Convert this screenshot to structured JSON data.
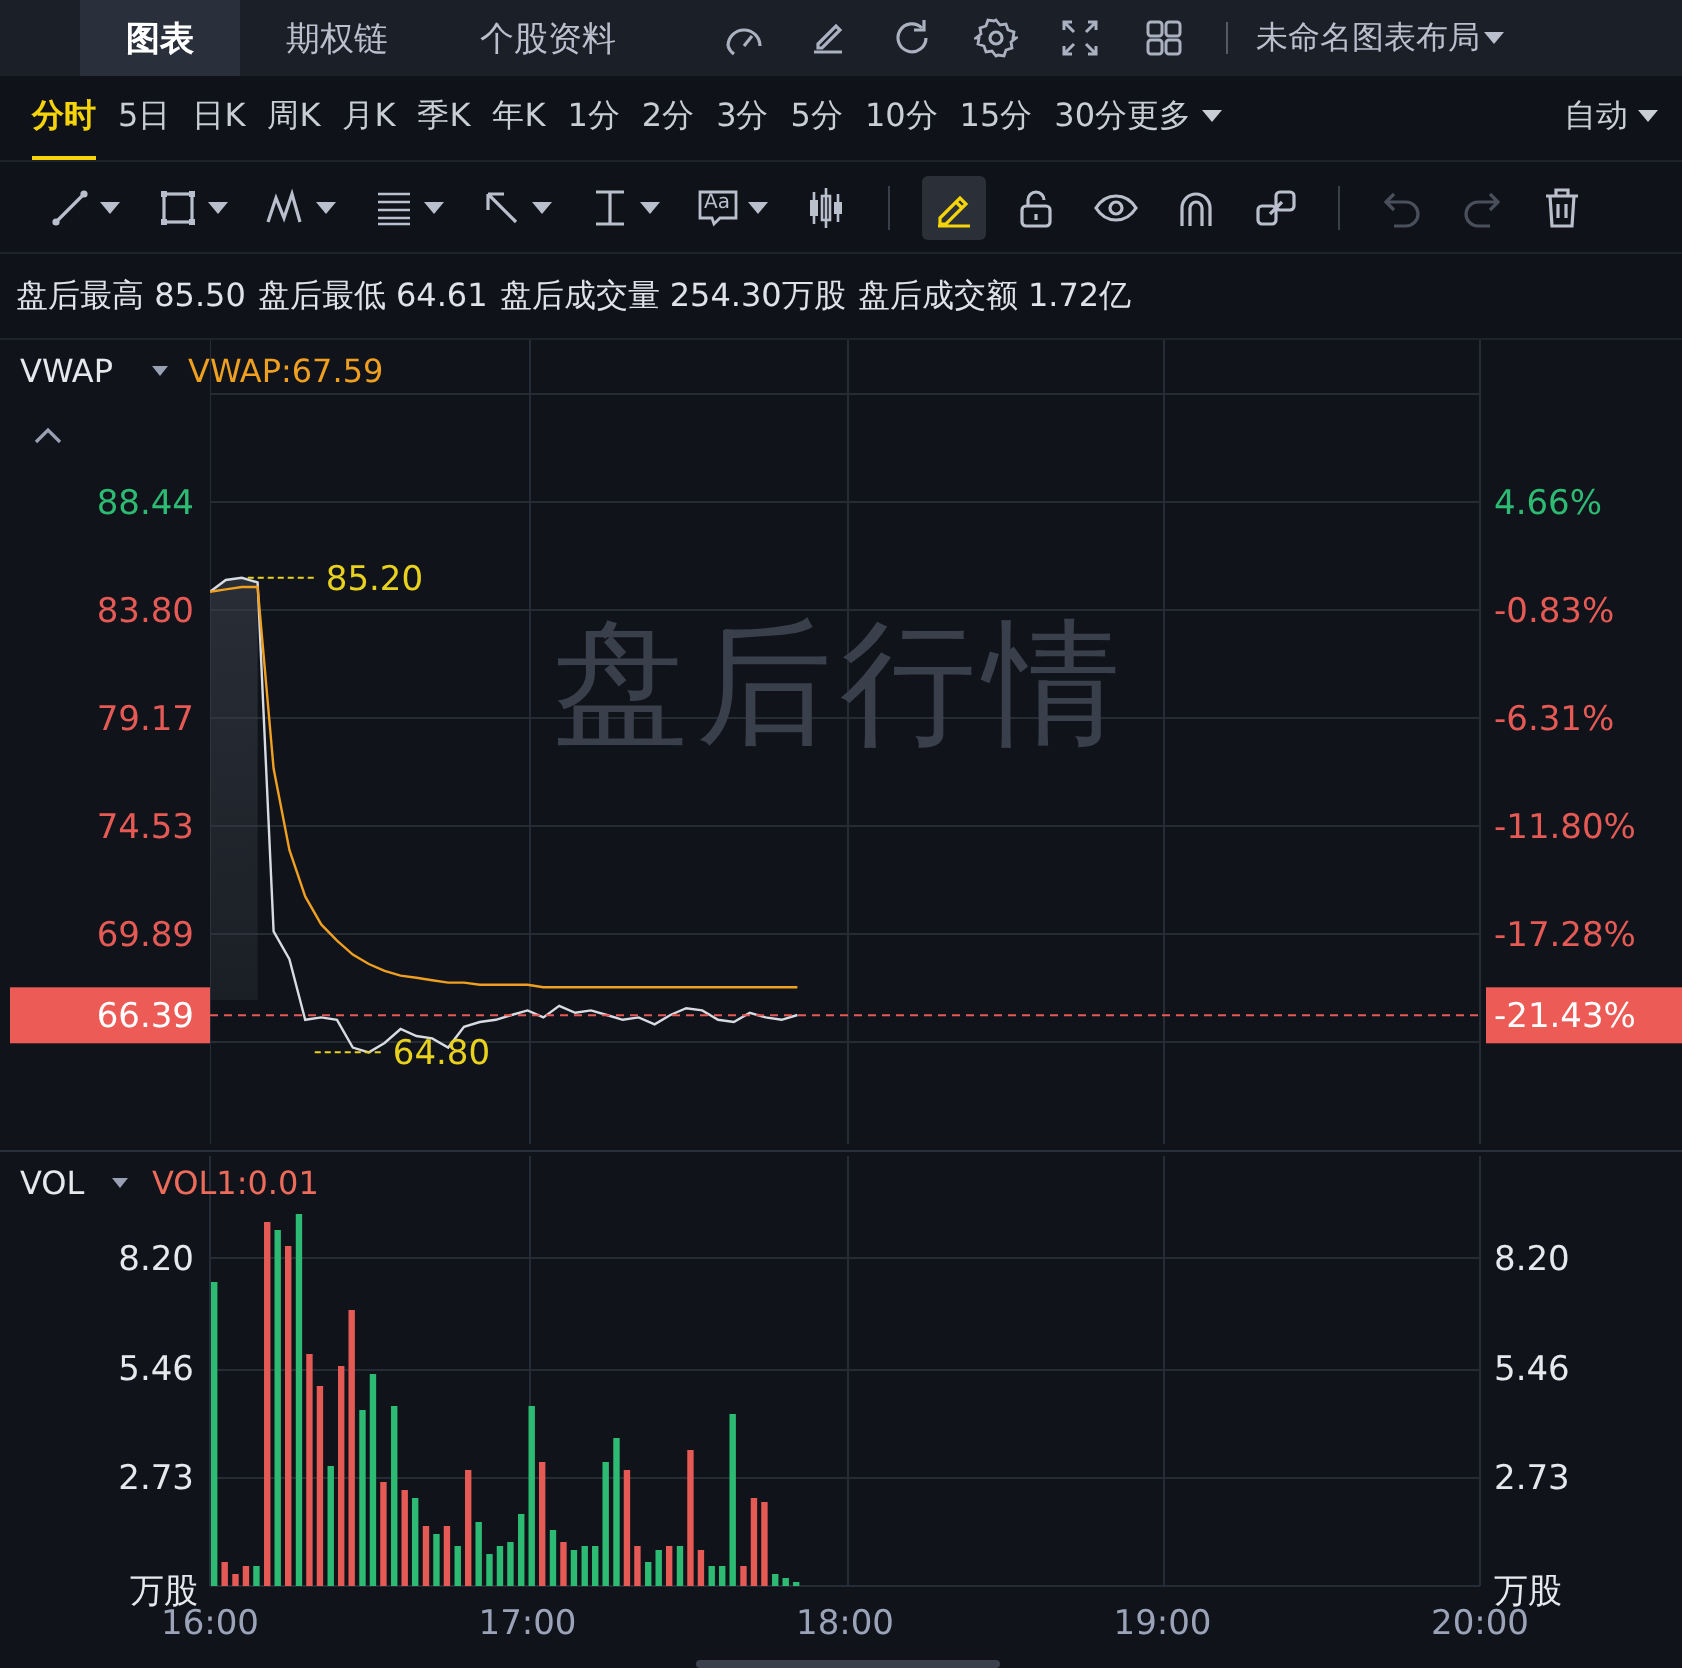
{
  "top_bar": {
    "tabs": [
      {
        "label": "图表",
        "selected": true
      },
      {
        "label": "期权链",
        "selected": false
      },
      {
        "label": "个股资料",
        "selected": false
      }
    ],
    "icons": [
      {
        "kind": "gauge"
      },
      {
        "kind": "edit"
      },
      {
        "kind": "refresh"
      },
      {
        "kind": "settings"
      },
      {
        "kind": "fullscreen"
      },
      {
        "kind": "layout"
      }
    ],
    "layout_name": "未命名图表布局"
  },
  "periods": [
    {
      "label": "分时",
      "selected": true
    },
    {
      "label": "5日",
      "selected": false
    },
    {
      "label": "日K",
      "selected": false
    },
    {
      "label": "周K",
      "selected": false
    },
    {
      "label": "月K",
      "selected": false
    },
    {
      "label": "季K",
      "selected": false
    },
    {
      "label": "年K",
      "selected": false
    },
    {
      "label": "1分",
      "selected": false
    },
    {
      "label": "2分",
      "selected": false
    },
    {
      "label": "3分",
      "selected": false
    },
    {
      "label": "5分",
      "selected": false
    },
    {
      "label": "10分",
      "selected": false
    },
    {
      "label": "15分",
      "selected": false
    },
    {
      "label": "30分",
      "selected": false
    }
  ],
  "more_periods": "更多",
  "scale_mode": "自动",
  "tools": [
    {
      "kind": "line",
      "dropdown": true,
      "selected": false,
      "disabled": false
    },
    {
      "kind": "rect",
      "dropdown": true,
      "selected": false,
      "disabled": false
    },
    {
      "kind": "pattern",
      "dropdown": true,
      "selected": false,
      "disabled": false
    },
    {
      "kind": "fib",
      "dropdown": true,
      "selected": false,
      "disabled": false
    },
    {
      "kind": "arrow",
      "dropdown": true,
      "selected": false,
      "disabled": false
    },
    {
      "kind": "measure",
      "dropdown": true,
      "selected": false,
      "disabled": false
    },
    {
      "kind": "text",
      "label": "Aa",
      "dropdown": true,
      "selected": false,
      "disabled": false
    },
    {
      "kind": "candles",
      "dropdown": false,
      "selected": false,
      "disabled": false
    },
    {
      "kind": "separator"
    },
    {
      "kind": "pencil",
      "dropdown": false,
      "selected": true,
      "disabled": false
    },
    {
      "kind": "lock",
      "dropdown": false,
      "selected": false,
      "disabled": false
    },
    {
      "kind": "eye",
      "dropdown": false,
      "selected": false,
      "disabled": false
    },
    {
      "kind": "magnet",
      "dropdown": false,
      "selected": false,
      "disabled": false
    },
    {
      "kind": "link",
      "dropdown": false,
      "selected": false,
      "disabled": false
    },
    {
      "kind": "separator"
    },
    {
      "kind": "undo",
      "dropdown": false,
      "selected": false,
      "disabled": true
    },
    {
      "kind": "redo",
      "dropdown": false,
      "selected": false,
      "disabled": true
    },
    {
      "kind": "trash",
      "dropdown": false,
      "selected": false,
      "disabled": false
    }
  ],
  "stats": [
    {
      "label": "盘后最高",
      "value": "85.50"
    },
    {
      "label": "盘后最低",
      "value": "64.61"
    },
    {
      "label": "盘后成交量",
      "value": "254.30万股"
    },
    {
      "label": "盘后成交额",
      "value": "1.72亿"
    }
  ],
  "price_panel": {
    "indicator": "VWAP",
    "indicator_value": "VWAP:67.59",
    "background_label": "盘后行情",
    "right_axis": [
      {
        "label": "4.66%",
        "color": "#2dbb73"
      },
      {
        "label": "-0.83%",
        "color": "#e55a55"
      },
      {
        "label": "-6.31%",
        "color": "#e55a55"
      },
      {
        "label": "-11.80%",
        "color": "#e55a55"
      },
      {
        "label": "-17.28%",
        "color": "#e55a55"
      }
    ],
    "current_change": "-21.43%",
    "chart_data": {
      "type": "line",
      "grid": true,
      "ref_lines": [
        {
          "value": 66.39,
          "axis": "y",
          "label": "66.39",
          "color": "#e55a55"
        }
      ],
      "categories": [
        null,
        null,
        null,
        null,
        null,
        null,
        null,
        null,
        null,
        null,
        null,
        null,
        null,
        null,
        null,
        null,
        null,
        null,
        null,
        null,
        null,
        null,
        null,
        null,
        null,
        null,
        null,
        null,
        null,
        null,
        null,
        null,
        null,
        null,
        null,
        null,
        null,
        null,
        null,
        null,
        null,
        null,
        null,
        null,
        null,
        null,
        null,
        null,
        null,
        null,
        null,
        null,
        null,
        null,
        null,
        null,
        null,
        null,
        null,
        null,
        null,
        null,
        null,
        null,
        null,
        null,
        null,
        null,
        null,
        null,
        null,
        null,
        null,
        null,
        null,
        null,
        null,
        null,
        null,
        null,
        null
      ],
      "series": [
        {
          "color": "#d8dbe2",
          "values": [
            84.6,
            85.1,
            85.2,
            85.0,
            70.0,
            68.8,
            66.2,
            66.3,
            66.2,
            65.0,
            64.8,
            65.2,
            65.8,
            65.5,
            65.4,
            65.0,
            65.9,
            66.1,
            66.2,
            66.4,
            66.6,
            66.3,
            66.8,
            66.5,
            66.6,
            66.4,
            66.2,
            66.3,
            66.0,
            66.4,
            66.7,
            66.6,
            66.2,
            66.1,
            66.5,
            66.3,
            66.2,
            66.4,
            null,
            null,
            null,
            null,
            null,
            null,
            null,
            null,
            null,
            null,
            null,
            null,
            null,
            null,
            null,
            null,
            null,
            null,
            null,
            null,
            null,
            null,
            null,
            null,
            null,
            null,
            null,
            null,
            null,
            null,
            null,
            null,
            null,
            null,
            null,
            null,
            null,
            null,
            null,
            null,
            null,
            null,
            null
          ]
        },
        {
          "color": "#f0a020",
          "values": [
            84.6,
            84.7,
            84.8,
            84.8,
            77.0,
            73.5,
            71.5,
            70.3,
            69.6,
            69.0,
            68.6,
            68.3,
            68.1,
            68.0,
            67.9,
            67.8,
            67.8,
            67.7,
            67.7,
            67.7,
            67.7,
            67.6,
            67.6,
            67.6,
            67.6,
            67.6,
            67.6,
            67.6,
            67.6,
            67.6,
            67.6,
            67.6,
            67.6,
            67.6,
            67.6,
            67.6,
            67.6,
            67.6,
            null,
            null,
            null,
            null,
            null,
            null,
            null,
            null,
            null,
            null,
            null,
            null,
            null,
            null,
            null,
            null,
            null,
            null,
            null,
            null,
            null,
            null,
            null,
            null,
            null,
            null,
            null,
            null,
            null,
            null,
            null,
            null,
            null,
            null,
            null,
            null,
            null,
            null,
            null,
            null,
            null,
            null,
            null
          ]
        }
      ],
      "ylim": [
        60.6,
        93.1
      ],
      "yticks": [
        {
          "value": 88.44,
          "label": "88.44"
        },
        {
          "value": 83.8,
          "label": "83.80"
        },
        {
          "value": 79.17,
          "label": "79.17"
        },
        {
          "value": 74.53,
          "label": "74.53"
        },
        {
          "value": 69.89,
          "label": "69.89"
        }
      ],
      "annotations": [
        "85.20",
        "64.80"
      ]
    }
  },
  "volume_panel": {
    "indicator": "VOL",
    "indicator_value": "VOL1:0.01",
    "unit_left": "万股",
    "unit_right": "万股",
    "right_ticks": [
      "8.20",
      "5.46",
      "2.73"
    ],
    "chart_data": {
      "type": "bar",
      "stacked": true,
      "grid": true,
      "x": [
        16,
        16.033,
        16.067,
        16.1,
        16.133,
        16.167,
        16.2,
        16.233,
        16.267,
        16.3,
        16.333,
        16.367,
        16.4,
        16.433,
        16.467,
        16.5,
        16.533,
        16.567,
        16.6,
        16.633,
        16.667,
        16.7,
        16.733,
        16.767,
        16.8,
        16.833,
        16.867,
        16.9,
        16.933,
        16.967,
        17,
        17.033,
        17.067,
        17.1,
        17.133,
        17.167,
        17.2,
        17.233,
        17.267,
        17.3,
        17.333,
        17.367,
        17.4,
        17.433,
        17.467,
        17.5,
        17.533,
        17.567,
        17.6,
        17.633,
        17.667,
        17.7,
        17.733,
        17.767,
        17.8,
        17.833
      ],
      "series": [
        {
          "color": "#e55a55",
          "values": [
            null,
            0.6,
            0.3,
            0.5,
            null,
            9.1,
            null,
            8.5,
            null,
            5.8,
            5.0,
            null,
            5.5,
            6.9,
            null,
            null,
            2.6,
            null,
            2.4,
            null,
            1.5,
            null,
            1.5,
            null,
            2.9,
            null,
            null,
            null,
            null,
            null,
            null,
            3.1,
            null,
            1.1,
            null,
            null,
            null,
            null,
            null,
            2.9,
            1.0,
            null,
            null,
            1.0,
            null,
            3.4,
            0.9,
            null,
            null,
            null,
            0.5,
            2.2,
            2.1,
            null,
            null,
            null
          ]
        },
        {
          "color": "#2dbb73",
          "values": [
            7.6,
            null,
            null,
            null,
            0.5,
            null,
            8.9,
            null,
            9.3,
            null,
            null,
            3.0,
            null,
            null,
            4.4,
            5.3,
            null,
            4.5,
            null,
            2.2,
            null,
            1.3,
            null,
            1.0,
            null,
            1.6,
            0.8,
            1.0,
            1.1,
            1.8,
            4.5,
            null,
            1.4,
            null,
            0.9,
            1.0,
            1.0,
            3.1,
            3.7,
            null,
            null,
            0.6,
            0.9,
            null,
            1.0,
            null,
            null,
            0.5,
            0.5,
            4.3,
            null,
            null,
            null,
            0.3,
            0.2,
            0.1
          ]
        }
      ],
      "xlim": [
        16,
        20
      ],
      "ylim": [
        0,
        10.9
      ],
      "yticks": [
        {
          "value": 8.2,
          "label": "8.20"
        },
        {
          "value": 5.46,
          "label": "5.46"
        },
        {
          "value": 2.73,
          "label": "2.73"
        }
      ],
      "xticks": [
        {
          "value": 16,
          "label": "16:00"
        },
        {
          "value": 17,
          "label": "17:00"
        },
        {
          "value": 18,
          "label": "18:00"
        },
        {
          "value": 19,
          "label": "19:00"
        },
        {
          "value": 20,
          "label": "20:00"
        }
      ]
    }
  }
}
